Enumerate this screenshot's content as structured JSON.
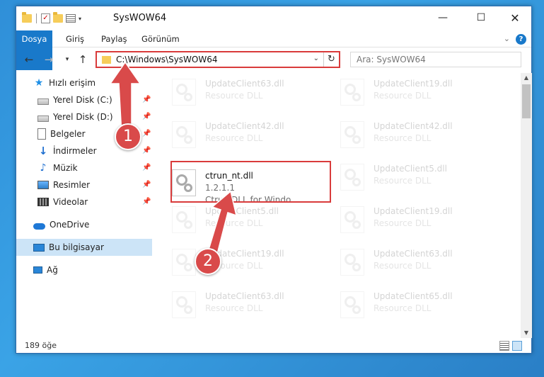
{
  "window": {
    "title": "SysWOW64",
    "controls": [
      "minimize-icon",
      "maximize-icon",
      "close-icon"
    ]
  },
  "ribbon": {
    "tabs": [
      "Dosya",
      "Giriş",
      "Paylaş",
      "Görünüm"
    ],
    "help_label": "?"
  },
  "nav": {
    "address": "C:\\Windows\\SysWOW64",
    "search_placeholder": "Ara: SysWOW64"
  },
  "sidebar": {
    "items": [
      {
        "label": "Hızlı erişim",
        "icon": "star-icon"
      },
      {
        "label": "Yerel Disk (C:)",
        "icon": "disk-icon",
        "pinned": true
      },
      {
        "label": "Yerel Disk (D:)",
        "icon": "disk-icon",
        "pinned": true
      },
      {
        "label": "Belgeler",
        "icon": "document-icon",
        "pinned": true
      },
      {
        "label": "İndirmeler",
        "icon": "download-icon",
        "pinned": true
      },
      {
        "label": "Müzik",
        "icon": "music-icon",
        "pinned": true
      },
      {
        "label": "Resimler",
        "icon": "pictures-icon",
        "pinned": true
      },
      {
        "label": "Videolar",
        "icon": "videos-icon",
        "pinned": true
      },
      {
        "label": "OneDrive",
        "icon": "cloud-icon"
      },
      {
        "label": "Bu bilgisayar",
        "icon": "computer-icon",
        "selected": true
      },
      {
        "label": "Ağ",
        "icon": "network-icon"
      }
    ]
  },
  "files": [
    {
      "name": "UpdateClient63.dll",
      "desc": "Resource DLL",
      "faded": true
    },
    {
      "name": "UpdateClient19.dll",
      "desc": "Resource DLL",
      "faded": true
    },
    {
      "name": "UpdateClient42.dll",
      "desc": "Resource DLL",
      "faded": true
    },
    {
      "name": "UpdateClient42.dll",
      "desc": "Resource DLL",
      "faded": true
    },
    {
      "name": "ctrun_nt.dll",
      "version": "1.2.1.1",
      "desc": "Ctrun DLL for Windo...",
      "faded": false
    },
    {
      "name": "UpdateClient5.dll",
      "desc": "Resource DLL",
      "faded": true
    },
    {
      "name": "UpdateClient5.dll",
      "desc": "Resource DLL",
      "faded": true
    },
    {
      "name": "UpdateClient19.dll",
      "desc": "Resource DLL",
      "faded": true
    },
    {
      "name": "UpdateClient19.dll",
      "desc": "Resource DLL",
      "faded": true
    },
    {
      "name": "UpdateClient63.dll",
      "desc": "Resource DLL",
      "faded": true
    },
    {
      "name": "UpdateClient63.dll",
      "desc": "Resource DLL",
      "faded": true
    },
    {
      "name": "UpdateClient65.dll",
      "desc": "Resource DLL",
      "faded": true
    }
  ],
  "status": {
    "count": "189 öğe"
  },
  "markers": {
    "step1": "1",
    "step2": "2",
    "color": "#d94a4a"
  }
}
